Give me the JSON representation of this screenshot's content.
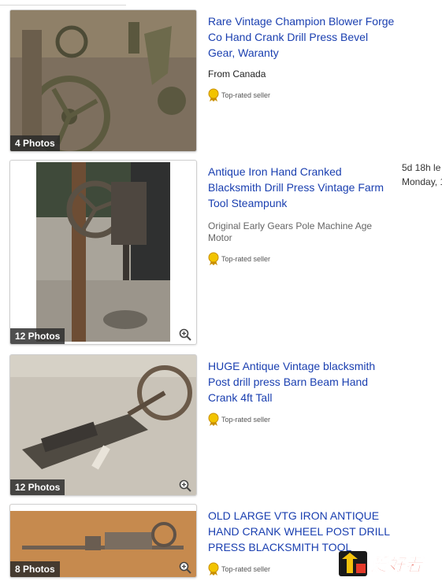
{
  "listings": [
    {
      "title": "Rare Vintage Champion Blower Forge Co Hand Crank Drill Press Bevel Gear, Waranty",
      "location": "From Canada",
      "photos": "4 Photos",
      "seller_badge": "Top-rated seller"
    },
    {
      "title": "Antique Iron Hand Cranked Blacksmith Drill Press Vintage Farm Tool Steampunk",
      "subtitle": "Original Early Gears Pole Machine Age Motor",
      "photos": "12 Photos",
      "seller_badge": "Top-rated seller",
      "time_left": "5d 18h le",
      "end_day": "Monday, 1"
    },
    {
      "title": "HUGE Antique Vintage blacksmith Post drill press Barn Beam Hand Crank 4ft Tall",
      "photos": "12 Photos",
      "seller_badge": "Top-rated seller"
    },
    {
      "title": "OLD LARGE VTG IRON ANTIQUE HAND CRANK WHEEL POST DRILL PRESS BLACKSMITH TOOL",
      "photos": "8 Photos",
      "seller_badge": "Top-rated seller"
    }
  ],
  "watermark_text": "爱好者",
  "colors": {
    "link": "#1a3fb0",
    "badge": "#e6b800"
  }
}
